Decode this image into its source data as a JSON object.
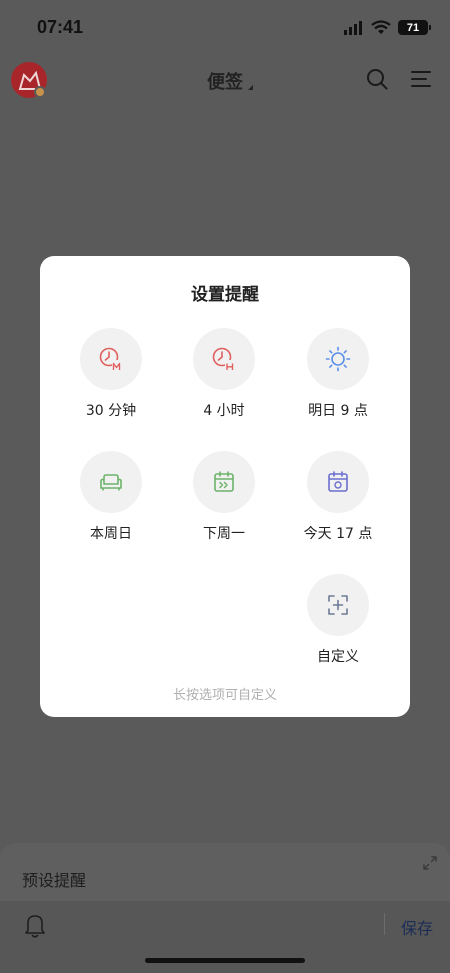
{
  "status_bar": {
    "time": "07:41",
    "battery": "71"
  },
  "header": {
    "title": "便签"
  },
  "reminder_modal": {
    "title": "设置提醒",
    "options": [
      {
        "label": "30 分钟",
        "icon": "clock-minutes-icon",
        "color": "#e0605e"
      },
      {
        "label": "4 小时",
        "icon": "clock-hours-icon",
        "color": "#e0605e"
      },
      {
        "label": "明日 9 点",
        "icon": "sun-icon",
        "color": "#5b8fe8"
      },
      {
        "label": "本周日",
        "icon": "sofa-icon",
        "color": "#6db36a"
      },
      {
        "label": "下周一",
        "icon": "calendar-next-week-icon",
        "color": "#6db36a"
      },
      {
        "label": "今天 17 点",
        "icon": "calendar-today-icon",
        "color": "#6b6fcf"
      },
      {
        "label": "自定义",
        "icon": "custom-add-icon",
        "color": "#6d7b95"
      }
    ],
    "hint": "长按选项可自定义"
  },
  "bottom_sheet": {
    "preset_label": "预设提醒",
    "save_label": "保存"
  }
}
